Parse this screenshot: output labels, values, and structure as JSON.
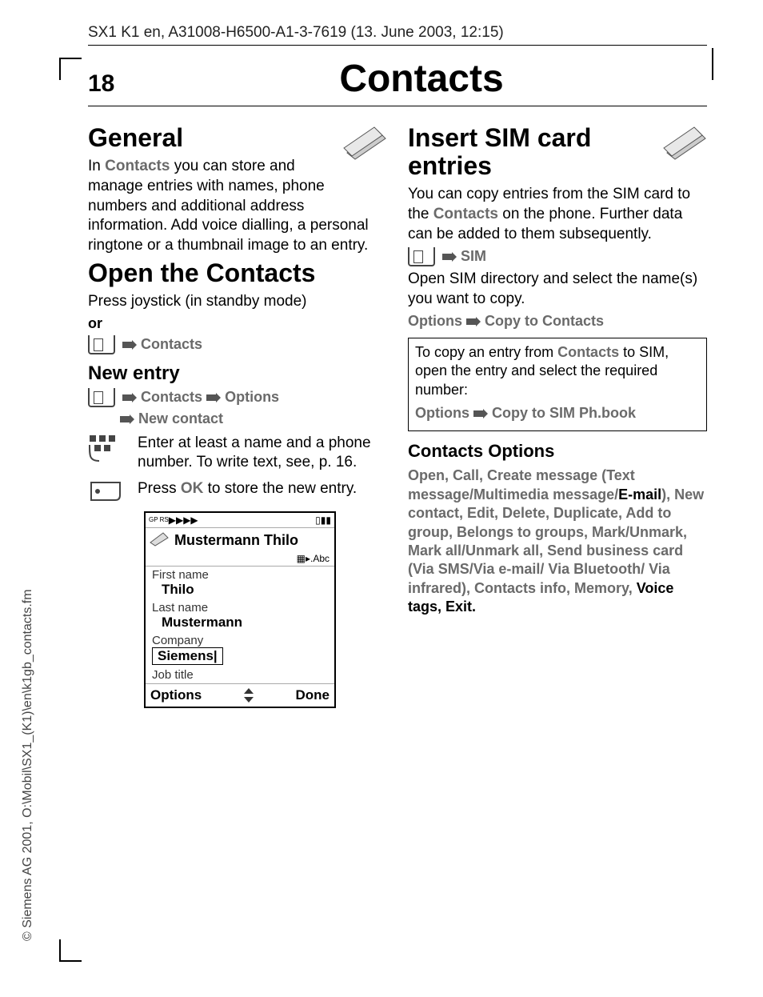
{
  "header": "SX1 K1 en, A31008-H6500-A1-3-7619 (13. June 2003, 12:15)",
  "page_number": "18",
  "page_title": "Contacts",
  "sideways": "© Siemens AG 2001, O:\\Mobil\\SX1_(K1)\\en\\k1gb_contacts.fm",
  "left": {
    "h_general": "General",
    "general_p1a": "In ",
    "general_p1b": "Contacts",
    "general_p1c": " you can store and manage entries with names, phone numbers and additional address information. Add voice dialling, a personal ringtone or a thumbnail image to an entry.",
    "h_open": "Open the Contacts",
    "open_p": "Press joystick (in standby mode)",
    "or": "or",
    "nav_contacts": "Contacts",
    "h_new": "New entry",
    "nav_options": "Options",
    "nav_newcontact": "New contact",
    "step1": "Enter at least a name and a phone number. To write text, see, p. 16.",
    "step2a": "Press ",
    "step2b": "OK",
    "step2c": " to store the new entry.",
    "phone": {
      "signal": "▶▶▶▶",
      "gprs": "GP\nRS",
      "batt": "▮▮",
      "title": "Mustermann Thilo",
      "mode": "▦▸.Abc",
      "f1_label": "First name",
      "f1_val": "Thilo",
      "f2_label": "Last name",
      "f2_val": "Mustermann",
      "f3_label": "Company",
      "f3_val": "Siemens|",
      "f4_label": "Job title",
      "left_soft": "Options",
      "right_soft": "Done"
    }
  },
  "right": {
    "h_insert": "Insert SIM card entries",
    "insert_p1a": "You can copy entries from the SIM card to the ",
    "insert_p1b": "Contacts",
    "insert_p1c": " on the phone. Further data can be added to them subsequently.",
    "nav_sim": "SIM",
    "insert_p2": "Open SIM directory and select the name(s) you want to copy.",
    "opt_label": "Options",
    "copy_contacts": "Copy to Contacts",
    "note_a": "To copy an entry from ",
    "note_b": "Contacts",
    "note_c": " to SIM, open the entry and select the required number:",
    "copy_sim": "Copy to SIM Ph.book",
    "h_contacts_options": "Contacts Options",
    "options_list": {
      "p1": "Open, Call, Create message (Text message/Multimedia message/",
      "email": "E-mail",
      "p2": "), New contact, Edit, Delete, Duplicate, Add to group, Belongs to groups, Mark/Unmark, Mark all/Unmark all, Send business card (Via SMS/Via e-mail/ Via Bluetooth/ Via infrared), Contacts info, Memory, ",
      "voice": "Voice tags, Exit."
    }
  }
}
